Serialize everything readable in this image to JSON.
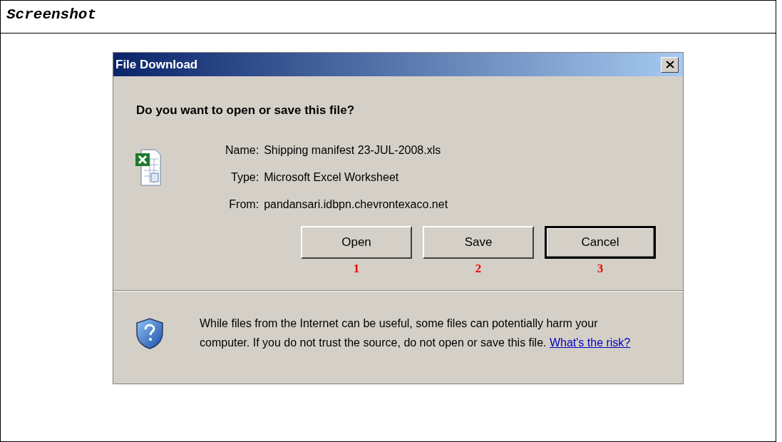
{
  "document": {
    "heading": "Screenshot"
  },
  "window": {
    "title": "File Download"
  },
  "question": "Do you want to open or save this file?",
  "file_info": [
    {
      "label": "Name:",
      "value": "Shipping manifest 23-JUL-2008.xls"
    },
    {
      "label": "Type:",
      "value": "Microsoft Excel Worksheet"
    },
    {
      "label": "From:",
      "value": "pandansari.idbpn.chevrontexaco.net"
    }
  ],
  "buttons": [
    {
      "label": "Open",
      "default": false,
      "annotation": "1"
    },
    {
      "label": "Save",
      "default": false,
      "annotation": "2"
    },
    {
      "label": "Cancel",
      "default": true,
      "annotation": "3"
    }
  ],
  "warning": {
    "text": "While files from the Internet can be useful, some files can potentially harm your computer. If you do not trust the source, do not open or save this file.",
    "link": "What's the risk?"
  }
}
